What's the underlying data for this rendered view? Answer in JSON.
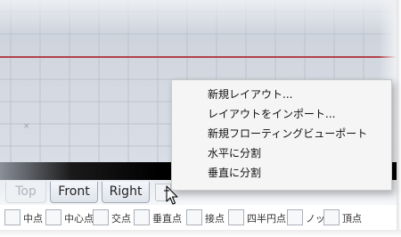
{
  "viewport_tabs": [
    {
      "label": "Top"
    },
    {
      "label": "Front"
    },
    {
      "label": "Right"
    }
  ],
  "viewport_marker": "×",
  "context_menu": [
    {
      "label": "新規レイアウト..."
    },
    {
      "label": "レイアウトをインポート..."
    },
    {
      "label": "新規フローティングビューポート"
    },
    {
      "label": "水平に分割"
    },
    {
      "label": "垂直に分割"
    }
  ],
  "osnap": [
    {
      "label": "中点"
    },
    {
      "label": "中心点"
    },
    {
      "label": "交点"
    },
    {
      "label": "垂直点"
    },
    {
      "label": "接点"
    },
    {
      "label": "四半円点"
    },
    {
      "label": "ノット"
    },
    {
      "label": "頂点"
    }
  ],
  "colors": {
    "axis": "#b2424a",
    "viewport_bg": "#d4d9e1",
    "menu_bg": "#f5f5f5"
  }
}
